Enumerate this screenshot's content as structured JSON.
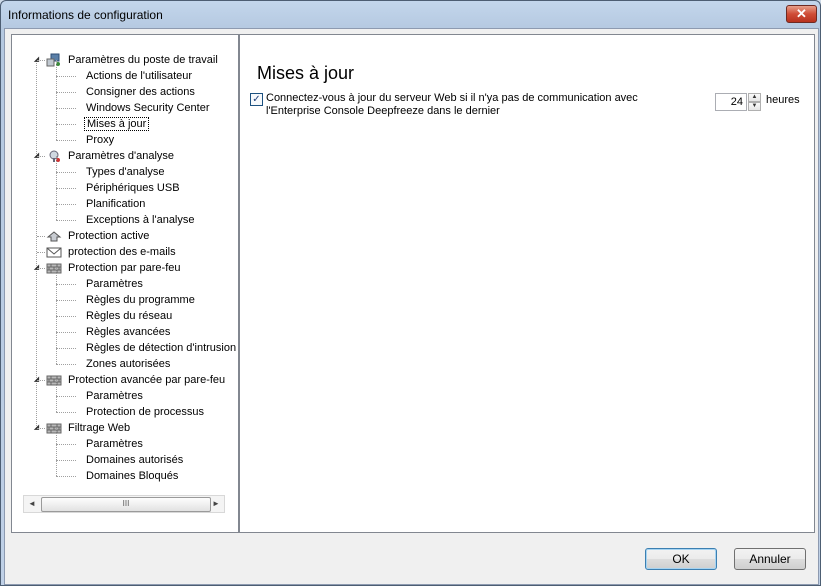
{
  "window": {
    "title": "Informations de configuration",
    "close_symbol": "✕"
  },
  "tree": {
    "items": [
      {
        "label": "Paramètres du poste de travail",
        "level": 0,
        "expanded": true,
        "icon": "workstation-icon"
      },
      {
        "label": "Actions de l'utilisateur",
        "level": 1
      },
      {
        "label": "Consigner des actions",
        "level": 1
      },
      {
        "label": "Windows Security Center",
        "level": 1
      },
      {
        "label": "Mises à jour",
        "level": 1,
        "selected": true
      },
      {
        "label": "Proxy",
        "level": 1
      },
      {
        "label": "Paramètres d'analyse",
        "level": 0,
        "expanded": true,
        "icon": "scan-icon"
      },
      {
        "label": "Types d'analyse",
        "level": 1
      },
      {
        "label": "Périphériques USB",
        "level": 1
      },
      {
        "label": "Planification",
        "level": 1
      },
      {
        "label": "Exceptions à l'analyse",
        "level": 1
      },
      {
        "label": "Protection active",
        "level": 0,
        "icon": "active-protection-icon"
      },
      {
        "label": "protection des e-mails",
        "level": 0,
        "icon": "email-icon"
      },
      {
        "label": "Protection par pare-feu",
        "level": 0,
        "expanded": true,
        "icon": "firewall-icon"
      },
      {
        "label": "Paramètres",
        "level": 1
      },
      {
        "label": "Règles du programme",
        "level": 1
      },
      {
        "label": "Règles du réseau",
        "level": 1
      },
      {
        "label": "Règles avancées",
        "level": 1
      },
      {
        "label": "Règles de détection d'intrusion",
        "level": 1
      },
      {
        "label": "Zones autorisées",
        "level": 1
      },
      {
        "label": "Protection avancée par pare-feu",
        "level": 0,
        "expanded": true,
        "icon": "firewall-icon"
      },
      {
        "label": "Paramètres",
        "level": 1
      },
      {
        "label": "Protection de processus",
        "level": 1
      },
      {
        "label": "Filtrage Web",
        "level": 0,
        "expanded": true,
        "icon": "firewall-icon"
      },
      {
        "label": "Paramètres",
        "level": 1
      },
      {
        "label": "Domaines autorisés",
        "level": 1
      },
      {
        "label": "Domaines Bloqués",
        "level": 1
      }
    ],
    "scrollbar": {
      "left_arrow": "◄",
      "right_arrow": "►",
      "grip": "III"
    }
  },
  "content": {
    "title": "Mises à jour",
    "option": {
      "checked": true,
      "check_symbol": "✓",
      "label": "Connectez-vous à jour du serveur Web si il n'ya pas de communication avec l'Enterprise Console Deepfreeze dans le dernier",
      "value": "24",
      "unit": "heures",
      "up": "▲",
      "down": "▼"
    }
  },
  "buttons": {
    "ok": "OK",
    "cancel": "Annuler"
  }
}
